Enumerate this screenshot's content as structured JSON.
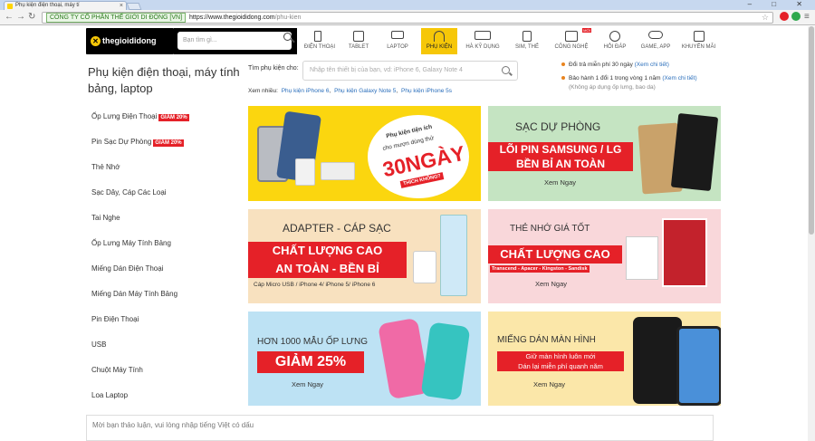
{
  "browser": {
    "tab_title": "Phụ kiện điện thoại, máy tí",
    "secure_label": "CÔNG TY CỔ PHẦN THẾ GIỚI DI ĐỘNG [VN]",
    "url_host": "https://www.thegioididong.com",
    "url_path": "/phu-kien",
    "window_controls": "– □ ✕"
  },
  "header": {
    "logo_text": "thegioididong",
    "search_placeholder": "Bạn tìm gì...",
    "nav": [
      {
        "label": "ĐIỆN THOẠI",
        "icon": "phone-icon"
      },
      {
        "label": "TABLET",
        "icon": "tablet-icon"
      },
      {
        "label": "LAPTOP",
        "icon": "laptop-icon"
      },
      {
        "label": "PHỤ KIỆN",
        "icon": "headphone-icon"
      },
      {
        "label": "HÀ KỸ DỤNG",
        "icon": "utility-icon"
      },
      {
        "label": "SIM, THẺ",
        "icon": "sim-icon"
      },
      {
        "label": "CÔNG NGHỆ",
        "icon": "tech-news-icon",
        "badge": "MỚI"
      },
      {
        "label": "HỎI ĐÁP",
        "icon": "question-icon"
      },
      {
        "label": "GAME, APP",
        "icon": "game-icon"
      },
      {
        "label": "KHUYẾN MÃI",
        "icon": "gift-icon"
      }
    ]
  },
  "sidebar": {
    "title": "Phụ kiện điện thoại, máy tính bảng, laptop",
    "items": [
      {
        "label": "Ốp Lưng Điện Thoại",
        "badge": "GIẢM 20%"
      },
      {
        "label": "Pin Sạc Dự Phòng",
        "badge": "GIẢM 20%"
      },
      {
        "label": "Thẻ Nhớ"
      },
      {
        "label": "Sạc Dây, Cáp Các Loại"
      },
      {
        "label": "Tai Nghe"
      },
      {
        "label": "Ốp Lưng Máy Tính Bảng"
      },
      {
        "label": "Miếng Dán Điện Thoại"
      },
      {
        "label": "Miếng Dán Máy Tính Bảng"
      },
      {
        "label": "Pin Điện Thoại"
      },
      {
        "label": "USB"
      },
      {
        "label": "Chuột Máy Tính"
      },
      {
        "label": "Loa Laptop"
      }
    ]
  },
  "accessory_search": {
    "label": "Tìm phụ kiện cho:",
    "placeholder": "Nhập tên thiết bị của bạn, vd: iPhone 6, Galaxy Note 4",
    "suggest_prefix": "Xem nhiều:",
    "suggestions": [
      "Phụ kiện iPhone 6",
      "Phụ kiện Galaxy Note 5",
      "Phụ kiện iPhone 5s"
    ]
  },
  "promos": [
    {
      "text": "Đổi trả miễn phí 30 ngày",
      "link": "(Xem chi tiết)"
    },
    {
      "text": "Bảo hành 1 đổi 1 trong vòng 1 năm",
      "link": "(Xem chi tiết)",
      "sub": "(Không áp dụng ốp lưng, bao da)"
    }
  ],
  "banners": [
    {
      "top": "Phụ kiện tiện ích",
      "middle": "cho mượn dùng thử",
      "big": "30NGÀY",
      "small": "THÍCH KHÔNG?",
      "colors": {
        "bg": "#fbd60f",
        "accent": "#e52128"
      }
    },
    {
      "title": "SẠC DỰ PHÒNG",
      "red1": "LÕI PIN SAMSUNG / LG",
      "red2": "BỀN BỈ AN TOÀN",
      "link": "Xem Ngay",
      "colors": {
        "bg": "#c5e4c2"
      }
    },
    {
      "title": "ADAPTER - CÁP SẠC",
      "red1": "CHẤT LƯỢNG CAO",
      "red2": "AN TOÀN - BỀN BỈ",
      "sub": "Cáp Micro USB / iPhone 4/ iPhone 5/ iPhone 6",
      "colors": {
        "bg": "#f8e1bf"
      }
    },
    {
      "title": "THẺ NHỚ GIÁ TỐT",
      "red1": "CHẤT LƯỢNG CAO",
      "sub": "Transcend - Apacer - Kingston - Sandisk",
      "link": "Xem Ngay",
      "colors": {
        "bg": "#f9d7da"
      }
    },
    {
      "title": "HƠN 1000 MẪU ỐP LƯNG",
      "red1": "GIẢM 25%",
      "link": "Xem Ngay",
      "colors": {
        "bg": "#bde2f4"
      }
    },
    {
      "title": "MIẾNG DÁN MÀN HÌNH",
      "red1": "Giữ màn hình luôn mới",
      "red2": "Dán lại miễn phí quanh năm",
      "link": "Xem Ngay",
      "colors": {
        "bg": "#fbe7a9"
      }
    }
  ],
  "chat": {
    "placeholder": "Mời bạn thảo luận, vui lòng nhập tiếng Việt có dấu"
  },
  "colors": {
    "brand": "#f6c708",
    "red": "#e52128",
    "link": "#2a6ebb"
  }
}
